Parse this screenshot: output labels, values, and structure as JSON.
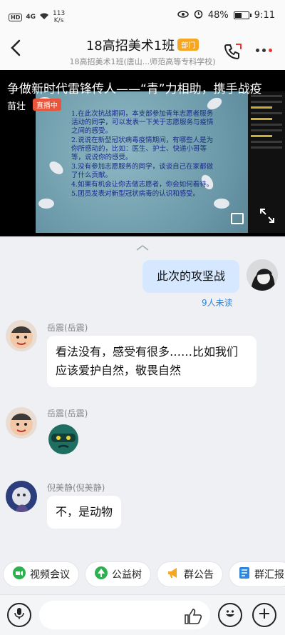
{
  "status_bar": {
    "hd": "HD",
    "sim": "4G",
    "net_speed": "113",
    "net_unit": "K/s",
    "battery": "48%",
    "battery_level": 0.48,
    "time": "9:11"
  },
  "header": {
    "title": "18高招美术1班",
    "badge": "部门",
    "subtitle": "18高招美术1班(唐山...师范高等专科学校)"
  },
  "live": {
    "title": "争做新时代雷锋传人——“青”力相助，携手战疫",
    "host": "苗壮",
    "status": "直播中",
    "slide_lines": [
      "1.在此次抗战期间，本支部参加青年志愿者服务活动的同学，可以发表一下关于志愿服务与疫情之间的感受。",
      "2.说说在新型冠状病毒疫情期间，有哪些人是为你所感动的，比如：医生、护士、快递小哥等等，说说你的感受。",
      "3.没有参加志愿服务的同学，谈谈自己在家都做了什么贡献。",
      "4.如果有机会让你去做志愿者，你会如何看待。",
      "5.团员发表对新型冠状病毒的认识和感受。"
    ]
  },
  "messages": [
    {
      "from": "me",
      "text": "此次的攻坚战",
      "read_status": "9人未读"
    },
    {
      "from": "other",
      "sender": "岳震(岳震)",
      "text": "看法没有，感受有很多……比如我们应该爱护自然，敬畏自然"
    },
    {
      "from": "other",
      "sender": "岳震(岳震)",
      "sticker": "ninja-sticker"
    },
    {
      "from": "other",
      "sender": "倪美静(倪美静)",
      "text": "不，是动物"
    }
  ],
  "quick_actions": [
    {
      "label": "视频会议",
      "icon": "video-icon",
      "color": "#2bb24c"
    },
    {
      "label": "公益树",
      "icon": "tree-icon",
      "color": "#2bb24c"
    },
    {
      "label": "群公告",
      "icon": "megaphone-icon",
      "color": "#f5a623"
    },
    {
      "label": "群汇报",
      "icon": "report-icon",
      "color": "#2e86de"
    }
  ],
  "input": {
    "placeholder": ""
  },
  "colors": {
    "accent": "#2e86de",
    "live_badge": "#e8553b",
    "dept_badge": "#f5a623",
    "my_bubble": "#d6e8ff"
  }
}
